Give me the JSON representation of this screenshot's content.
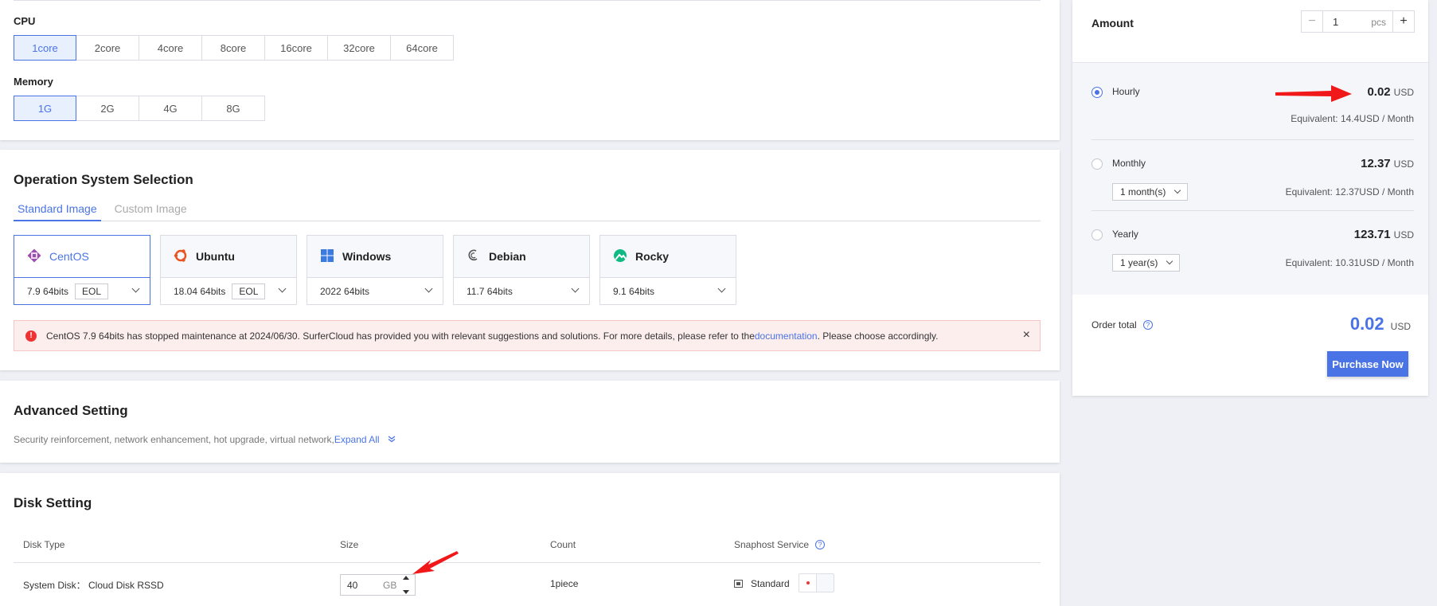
{
  "cpu": {
    "label": "CPU",
    "options": [
      "1core",
      "2core",
      "4core",
      "8core",
      "16core",
      "32core",
      "64core"
    ],
    "selected": "1core"
  },
  "memory": {
    "label": "Memory",
    "options": [
      "1G",
      "2G",
      "4G",
      "8G"
    ],
    "selected": "1G"
  },
  "os": {
    "title": "Operation System Selection",
    "tabs": [
      "Standard Image",
      "Custom Image"
    ],
    "active_tab": "Standard Image",
    "images": [
      {
        "name": "CentOS",
        "version": "7.9 64bits",
        "badge": "EOL",
        "icon": "centos-icon"
      },
      {
        "name": "Ubuntu",
        "version": "18.04 64bits",
        "badge": "EOL",
        "icon": "ubuntu-icon"
      },
      {
        "name": "Windows",
        "version": "2022 64bits",
        "badge": "",
        "icon": "windows-icon"
      },
      {
        "name": "Debian",
        "version": "11.7 64bits",
        "badge": "",
        "icon": "debian-icon"
      },
      {
        "name": "Rocky",
        "version": "9.1 64bits",
        "badge": "",
        "icon": "rocky-icon"
      }
    ],
    "alert": {
      "text_before": "CentOS 7.9 64bits has stopped maintenance at 2024/06/30. SurferCloud has provided you with relevant suggestions and solutions. For more details, please refer to the ",
      "link": "documentation",
      "text_after": ". Please choose accordingly.",
      "close": "×"
    }
  },
  "advanced": {
    "title": "Advanced Setting",
    "desc": "Security reinforcement, network enhancement, hot upgrade, virtual network,",
    "expand": "Expand All"
  },
  "disk": {
    "title": "Disk Setting",
    "headers": {
      "type": "Disk Type",
      "size": "Size",
      "count": "Count",
      "snapshot": "Snaphost Service"
    },
    "row": {
      "type": "System Disk： Cloud Disk RSSD",
      "size": "40",
      "unit": "GB",
      "count": "1piece",
      "snapshot": "Standard"
    }
  },
  "order": {
    "amount_label": "Amount",
    "amount_value": "1",
    "amount_unit": "pcs",
    "minus": "−",
    "plus": "+",
    "plans": [
      {
        "name": "Hourly",
        "price": "0.02",
        "currency": "USD",
        "equiv": "Equivalent: 14.4USD / Month",
        "selected": true,
        "period": ""
      },
      {
        "name": "Monthly",
        "price": "12.37",
        "currency": "USD",
        "equiv": "Equivalent: 12.37USD / Month",
        "selected": false,
        "period": "1 month(s)"
      },
      {
        "name": "Yearly",
        "price": "123.71",
        "currency": "USD",
        "equiv": "Equivalent: 10.31USD / Month",
        "selected": false,
        "period": "1 year(s)"
      }
    ],
    "total_label": "Order total",
    "total_price": "0.02",
    "total_currency": "USD",
    "purchase": "Purchase Now"
  },
  "colors": {
    "accent": "#4a74e6",
    "alert_bg": "#fdeeee",
    "arrow": "#f01818"
  }
}
